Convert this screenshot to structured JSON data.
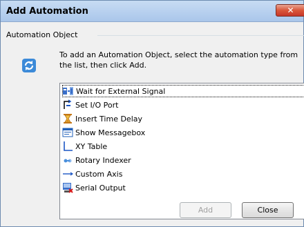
{
  "window": {
    "title": "Add Automation",
    "close_glyph": "✕"
  },
  "group": {
    "label": "Automation Object",
    "description": "To add an Automation Object, select the automation type from the list, then click Add."
  },
  "list": {
    "items": [
      {
        "label": "Wait for External Signal",
        "icon": "wait-signal-icon",
        "focused": true
      },
      {
        "label": "Set I/O Port",
        "icon": "io-port-icon"
      },
      {
        "label": "Insert Time Delay",
        "icon": "hourglass-icon"
      },
      {
        "label": "Show Messagebox",
        "icon": "messagebox-icon"
      },
      {
        "label": "XY Table",
        "icon": "xy-table-icon"
      },
      {
        "label": "Rotary Indexer",
        "icon": "rotary-indexer-icon"
      },
      {
        "label": "Custom Axis",
        "icon": "custom-axis-icon"
      },
      {
        "label": "Serial Output",
        "icon": "serial-output-icon"
      }
    ]
  },
  "buttons": {
    "add_label": "Add",
    "close_label": "Close"
  }
}
